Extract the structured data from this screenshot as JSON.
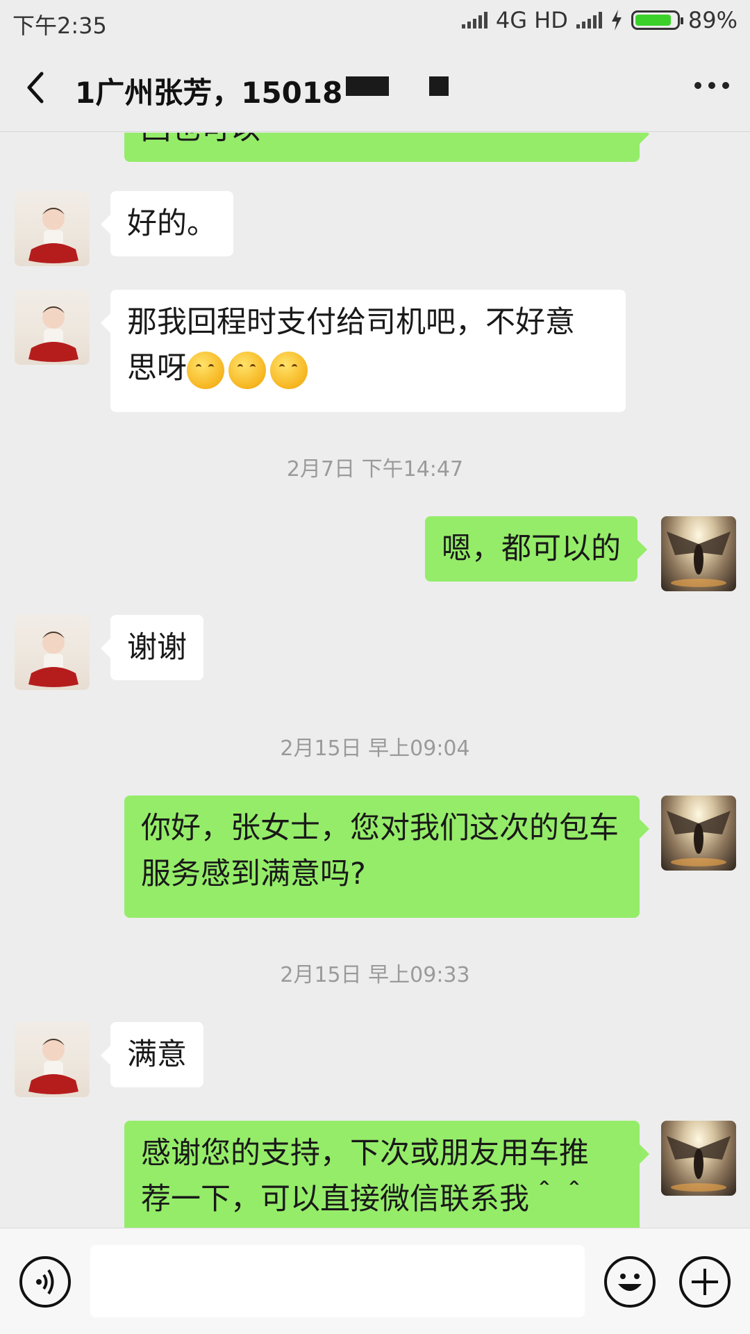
{
  "status_bar": {
    "time": "下午2:35",
    "network": "4G HD",
    "battery": "89%",
    "battery_level": 0.89
  },
  "header": {
    "title": "1广州张芳，15018",
    "back_icon": "chevron-left-icon",
    "more_icon": "more-dots-icon"
  },
  "messages": [
    {
      "side": "right",
      "text": "回也可以",
      "avatar": "angel"
    },
    {
      "side": "left",
      "text": "好的。",
      "avatar": "baby"
    },
    {
      "side": "left",
      "text_line1": "那我回程时支付给司机吧，不好意",
      "text_line2": "思呀",
      "emoji_count": 3,
      "avatar": "baby"
    },
    {
      "type": "timestamp",
      "text": "2月7日 下午14:47"
    },
    {
      "side": "right",
      "text": "嗯，都可以的",
      "avatar": "angel"
    },
    {
      "side": "left",
      "text": "谢谢",
      "avatar": "baby"
    },
    {
      "type": "timestamp",
      "text": "2月15日 早上09:04"
    },
    {
      "side": "right",
      "text_line1": "你好，张女士，您对我们这次的包车",
      "text_line2": "服务感到满意吗?",
      "avatar": "angel"
    },
    {
      "type": "timestamp",
      "text": "2月15日 早上09:33"
    },
    {
      "side": "left",
      "text": "满意",
      "avatar": "baby"
    },
    {
      "side": "right",
      "text_line1": "感谢您的支持，下次或朋友用车推",
      "text_line2": "荐一下，可以直接微信联系我＾＾",
      "avatar": "angel"
    }
  ],
  "input_bar": {
    "voice_icon": "voice-icon",
    "emoji_icon": "emoji-icon",
    "plus_icon": "plus-icon"
  }
}
